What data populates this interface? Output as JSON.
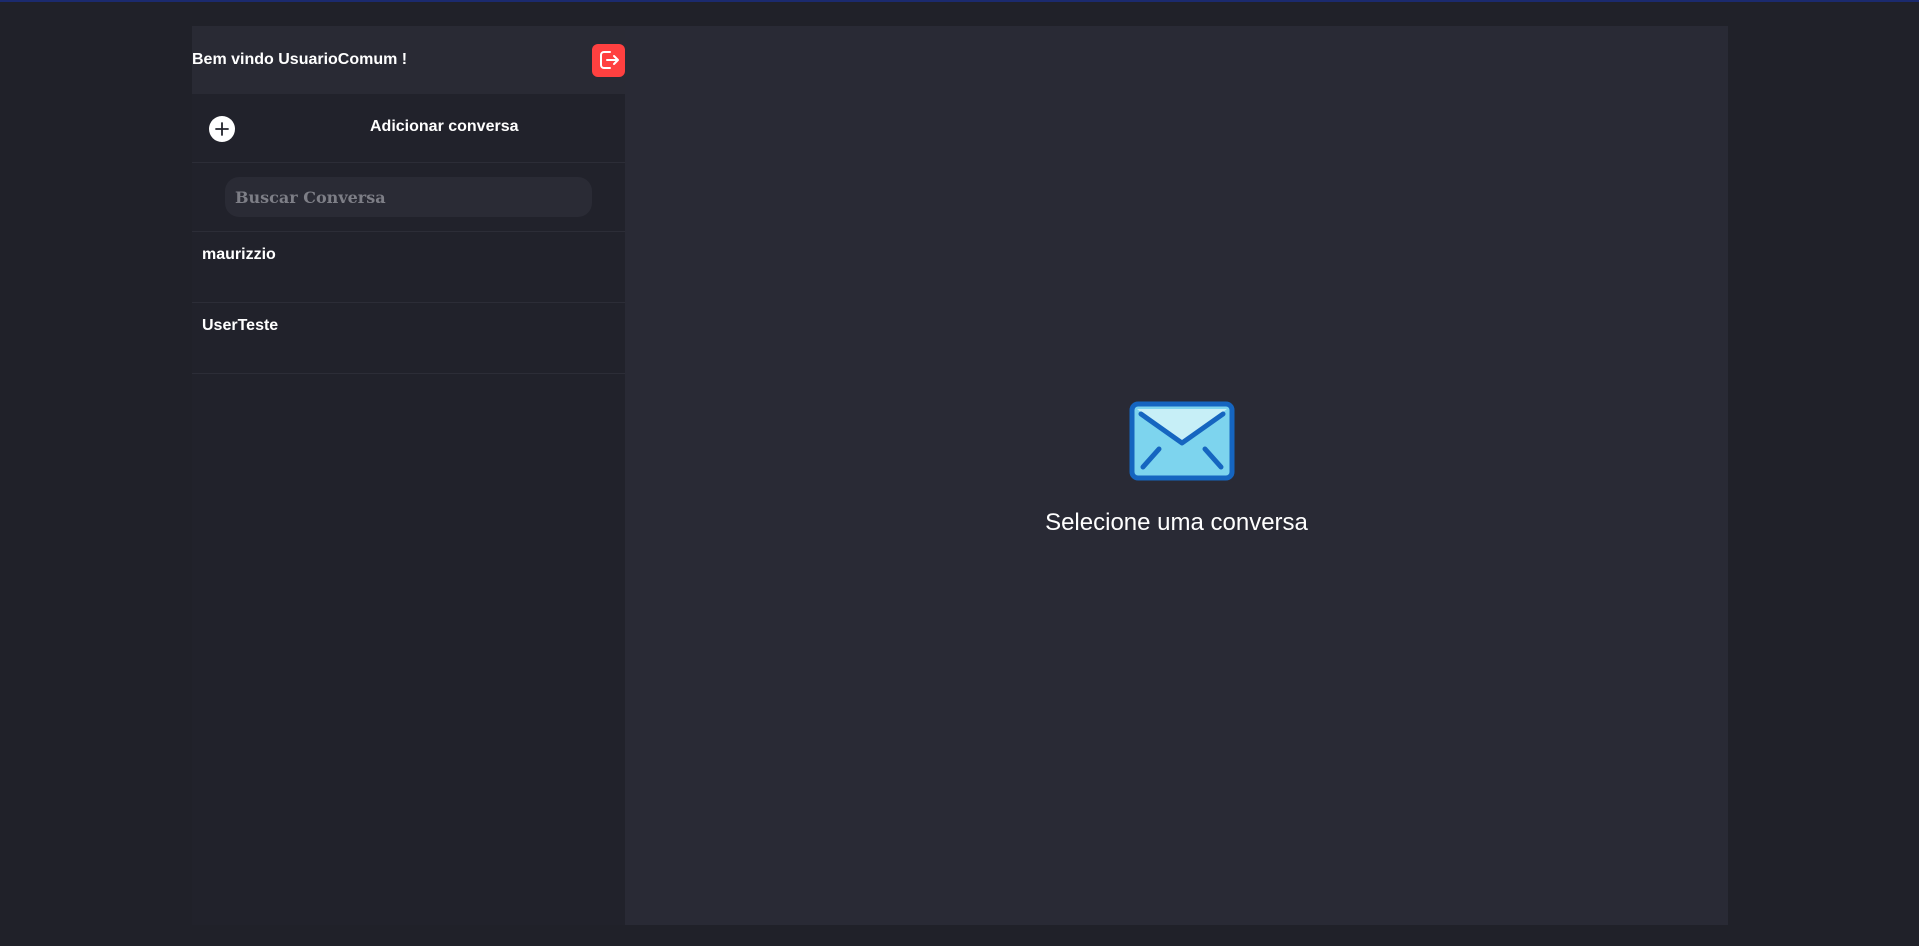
{
  "header": {
    "welcome_text": "Bem vindo UsuarioComum !",
    "logout_icon": "logout-icon",
    "logout_color": "#ff4040"
  },
  "sidebar": {
    "add_conversation_label": "Adicionar conversa",
    "add_icon": "plus-circle-icon",
    "search_placeholder": "Buscar Conversa",
    "search_value": "",
    "conversations": [
      {
        "name": "maurizzio"
      },
      {
        "name": "UserTeste"
      }
    ]
  },
  "main": {
    "empty_icon": "envelope-icon",
    "empty_text": "Selecione uma conversa"
  },
  "colors": {
    "background": "#202129",
    "sidebar": "#21222b",
    "header": "#292a34",
    "main_panel": "#292a35",
    "accent_logout": "#ff4040"
  }
}
